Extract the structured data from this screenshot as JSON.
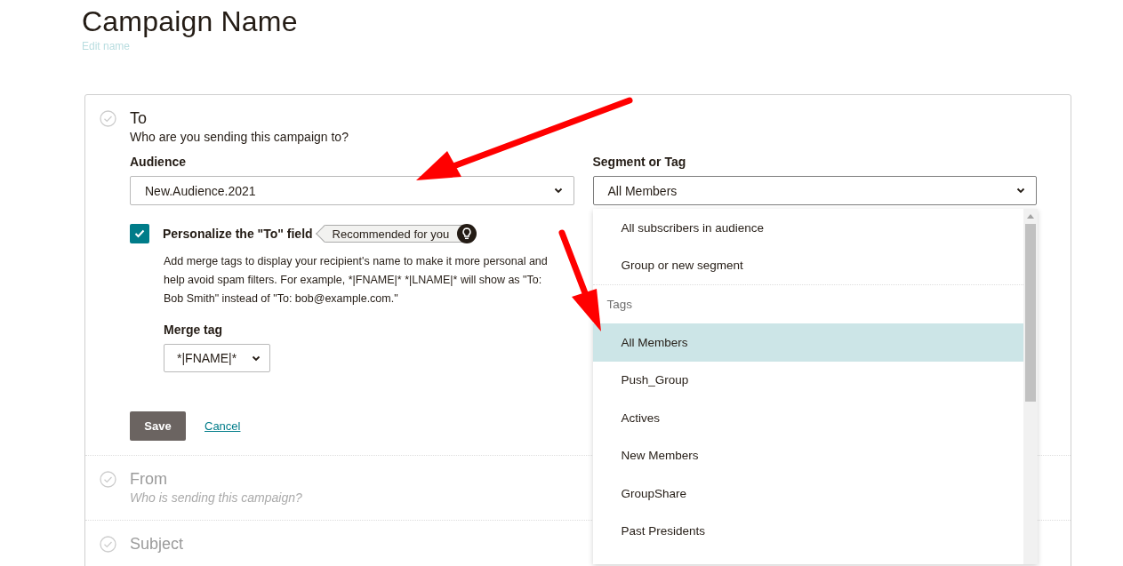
{
  "page": {
    "title": "Campaign Name",
    "edit_link": "Edit name"
  },
  "sections": [
    {
      "title": "To",
      "subtitle": "Who are you sending this campaign to?",
      "expanded": true
    },
    {
      "title": "From",
      "subtitle": "Who is sending this campaign?",
      "expanded": false
    },
    {
      "title": "Subject",
      "expanded": false
    }
  ],
  "audience": {
    "label": "Audience",
    "value": "New.Audience.2021"
  },
  "segment": {
    "label": "Segment or Tag",
    "value": "All Members",
    "expanded": true
  },
  "personalize": {
    "label": "Personalize the \"To\" field",
    "checked": true,
    "badge": "Recommended for you",
    "description": "Add merge tags to display your recipient's name to make it more personal and help avoid spam filters. For example, *|FNAME|* *|LNAME|* will show as \"To: Bob Smith\" instead of \"To: bob@example.com.\""
  },
  "merge_tag": {
    "label": "Merge tag",
    "value": "*|FNAME|*"
  },
  "buttons": {
    "save": "Save",
    "cancel": "Cancel"
  },
  "menu": [
    {
      "kind": "option",
      "label": "All subscribers in audience",
      "selected": false
    },
    {
      "kind": "option",
      "label": "Group or new segment",
      "selected": false
    },
    {
      "kind": "header",
      "label": "Tags"
    },
    {
      "kind": "option",
      "label": "All Members",
      "selected": true
    },
    {
      "kind": "option",
      "label": "Push_Group",
      "selected": false
    },
    {
      "kind": "option",
      "label": "Actives",
      "selected": false
    },
    {
      "kind": "option",
      "label": "New Members",
      "selected": false
    },
    {
      "kind": "option",
      "label": "GroupShare",
      "selected": false
    },
    {
      "kind": "option",
      "label": "Past Presidents",
      "selected": false
    }
  ]
}
